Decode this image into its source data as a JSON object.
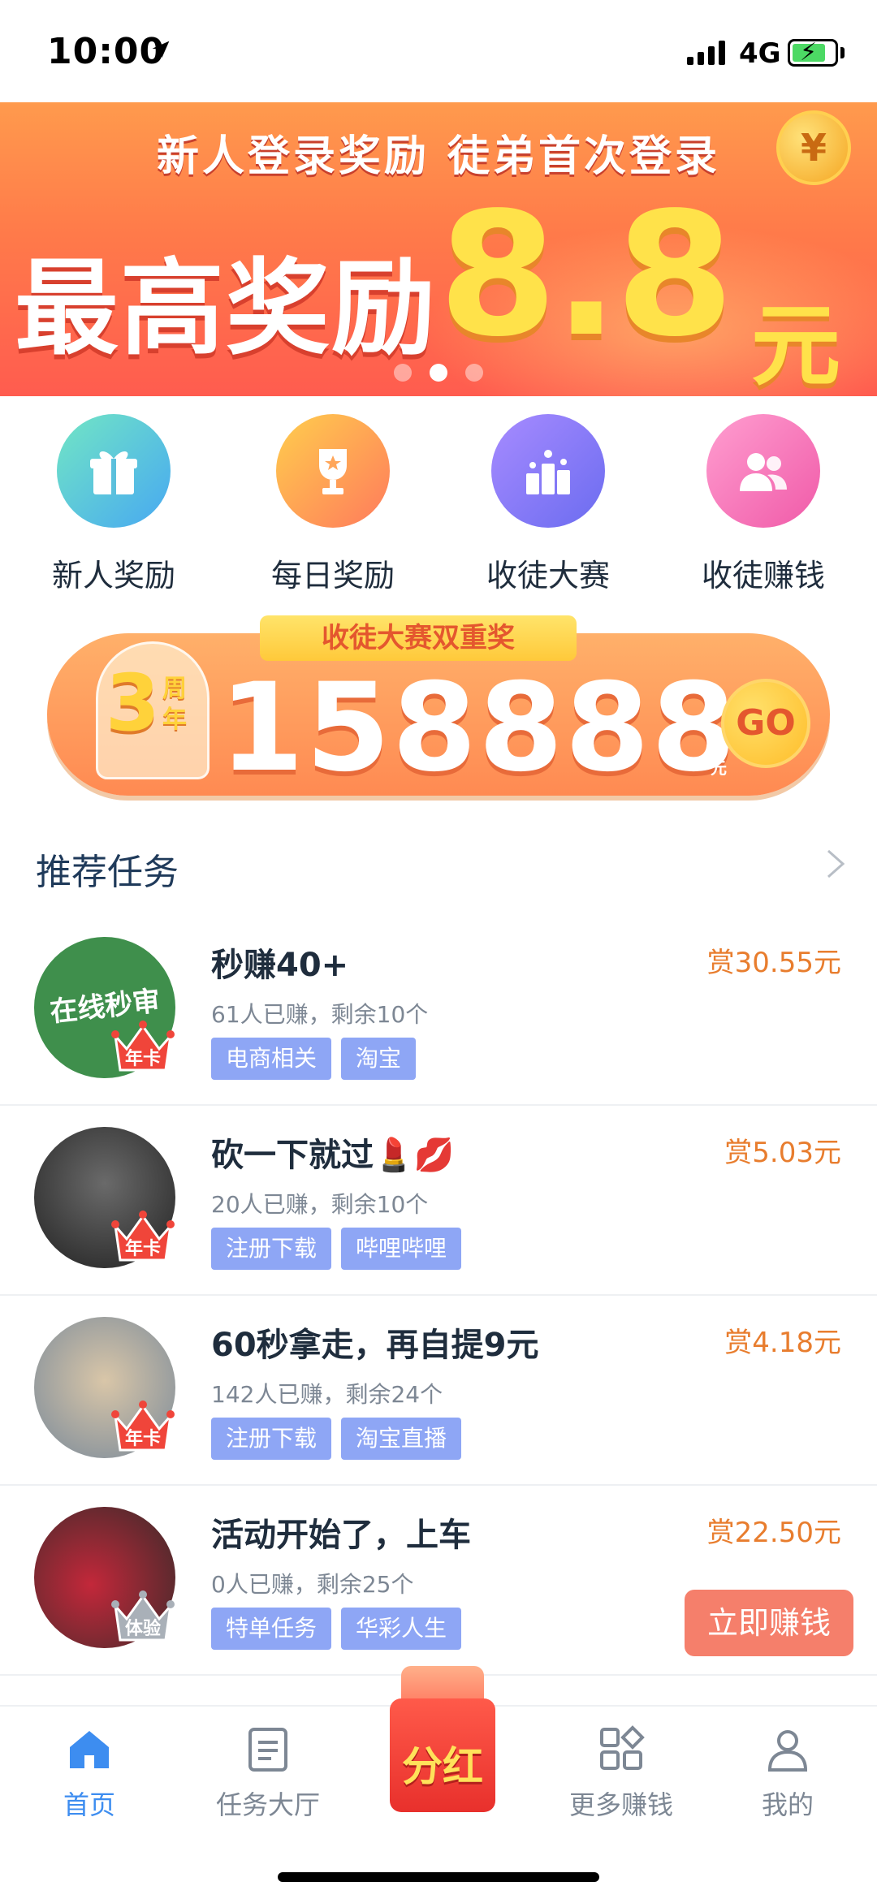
{
  "status_bar": {
    "time": "10:00",
    "network": "4G"
  },
  "banner": {
    "subtitle": "新人登录奖励 徒弟首次登录",
    "main_text": "最高奖励",
    "amount": "8.8",
    "unit": "元",
    "coin_symbol": "¥",
    "carousel_index": 1,
    "carousel_count": 3
  },
  "categories": [
    {
      "label": "新人奖励",
      "icon": "gift-icon"
    },
    {
      "label": "每日奖励",
      "icon": "trophy-icon"
    },
    {
      "label": "收徒大赛",
      "icon": "podium-icon"
    },
    {
      "label": "收徒赚钱",
      "icon": "people-icon"
    }
  ],
  "contest": {
    "tag": "收徒大赛双重奖",
    "cup_number": "3",
    "cup_text": "周年",
    "amount": "158888",
    "unit": "元",
    "go_label": "GO"
  },
  "section": {
    "title": "推荐任务"
  },
  "tasks": [
    {
      "title": "秒赚40+",
      "meta": "61人已赚，剩余10个",
      "tags": [
        "电商相关",
        "淘宝"
      ],
      "reward": "赏30.55元",
      "badge": "年卡",
      "thumb_text": "在线秒审"
    },
    {
      "title": "砍一下就过💄💋",
      "meta": "20人已赚，剩余10个",
      "tags": [
        "注册下载",
        "哔哩哔哩"
      ],
      "reward": "赏5.03元",
      "badge": "年卡"
    },
    {
      "title": "60秒拿走，再自提9元",
      "meta": "142人已赚，剩余24个",
      "tags": [
        "注册下载",
        "淘宝直播"
      ],
      "reward": "赏4.18元",
      "badge": "年卡"
    },
    {
      "title": "活动开始了，上车",
      "meta": "0人已赚，剩余25个",
      "tags": [
        "特单任务",
        "华彩人生"
      ],
      "reward": "赏22.50元",
      "badge": "体验",
      "action": "立即赚钱"
    }
  ],
  "tabbar": {
    "items": [
      {
        "label": "首页",
        "icon": "home-icon",
        "active": true
      },
      {
        "label": "任务大厅",
        "icon": "task-list-icon",
        "active": false
      },
      {
        "label": "分红",
        "icon": "red-packet-icon",
        "active": false
      },
      {
        "label": "更多赚钱",
        "icon": "grid-icon",
        "active": false
      },
      {
        "label": "我的",
        "icon": "profile-icon",
        "active": false
      }
    ]
  },
  "colors": {
    "accent": "#3d8df0",
    "reward": "#e87d2e",
    "tag": "#8ea6f5",
    "action_button": "#f57f6b"
  }
}
